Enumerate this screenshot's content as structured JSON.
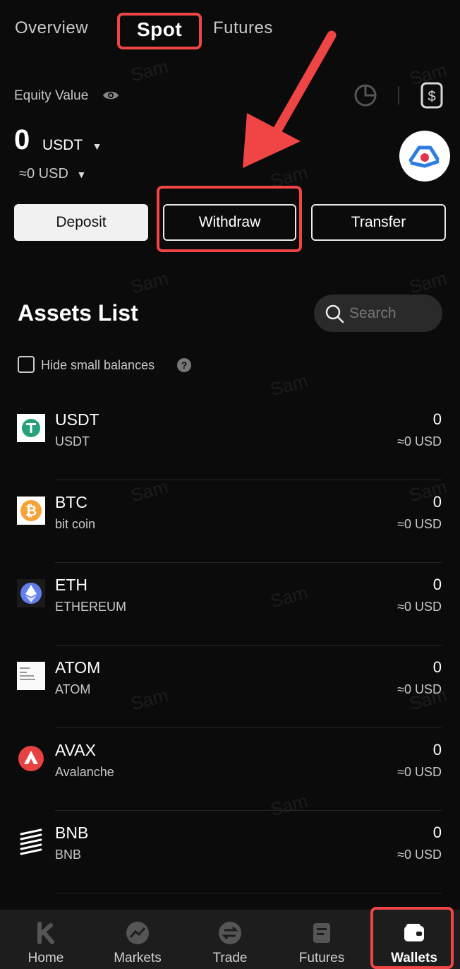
{
  "tabs": [
    "Overview",
    "Spot",
    "Futures"
  ],
  "watermark": "Sam",
  "equity": {
    "label": "Equity Value",
    "amount": "0",
    "currency": "USDT",
    "usd_value": "≈0 USD"
  },
  "actions": {
    "deposit": "Deposit",
    "withdraw": "Withdraw",
    "transfer": "Transfer"
  },
  "assets": {
    "title": "Assets List",
    "search_placeholder": "Search",
    "hide_small": "Hide small balances",
    "items": [
      {
        "symbol": "USDT",
        "name": "USDT",
        "amount": "0",
        "usd": "≈0 USD",
        "icon": "usdt-icon"
      },
      {
        "symbol": "BTC",
        "name": "bit coin",
        "amount": "0",
        "usd": "≈0 USD",
        "icon": "btc-icon"
      },
      {
        "symbol": "ETH",
        "name": "ETHEREUM",
        "amount": "0",
        "usd": "≈0 USD",
        "icon": "eth-icon"
      },
      {
        "symbol": "ATOM",
        "name": "ATOM",
        "amount": "0",
        "usd": "≈0 USD",
        "icon": "atom-icon"
      },
      {
        "symbol": "AVAX",
        "name": "Avalanche",
        "amount": "0",
        "usd": "≈0 USD",
        "icon": "avax-icon"
      },
      {
        "symbol": "BNB",
        "name": "BNB",
        "amount": "0",
        "usd": "≈0 USD",
        "icon": "bnb-icon"
      }
    ]
  },
  "nav": [
    "Home",
    "Markets",
    "Trade",
    "Futures",
    "Wallets"
  ],
  "colors": {
    "highlight": "#f04545",
    "background": "#0b0b0b",
    "nav_bg": "#1d1d1d"
  }
}
